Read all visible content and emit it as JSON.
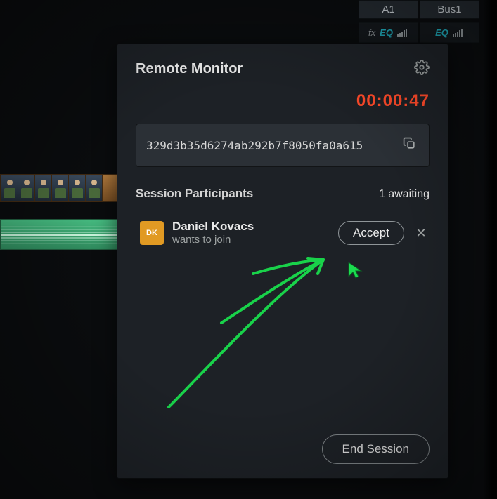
{
  "mixer": {
    "col1_label": "A1",
    "col2_label": "Bus1",
    "fx_label": "fx",
    "eq_label": "EQ"
  },
  "panel": {
    "title": "Remote Monitor",
    "timer": "00:00:47",
    "session_id": "329d3b35d6274ab292b7f8050fa0a615"
  },
  "participants": {
    "heading": "Session Participants",
    "awaiting": "1 awaiting",
    "requests": [
      {
        "initials": "DK",
        "name": "Daniel Kovacs",
        "subtext": "wants to join",
        "accept_label": "Accept"
      }
    ]
  },
  "footer": {
    "end_label": "End Session"
  }
}
